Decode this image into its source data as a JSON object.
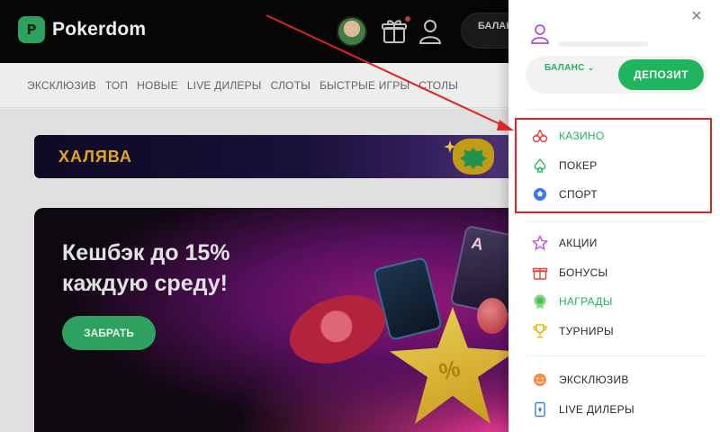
{
  "site": {
    "brand": "Pokerdom",
    "balance_label": "БАЛАН",
    "categories": [
      "ЭКСКЛЮЗИВ",
      "ТОП",
      "НОВЫЕ",
      "LIVE ДИЛЕРЫ",
      "СЛОТЫ",
      "БЫСТРЫЕ ИГРЫ",
      "СТОЛЫ"
    ],
    "freebie_banner": {
      "title": "ХАЛЯВА",
      "letter": "S"
    },
    "promo": {
      "title": "Кешбэк до 15% каждую среду!",
      "button": "ЗАБРАТЬ",
      "card_letter": "A",
      "star_symbol": "%"
    }
  },
  "drawer": {
    "close_glyph": "×",
    "wallet": {
      "balance_label": "БАЛАНС",
      "chevron": "⌄",
      "deposit_label": "ДЕПОЗИТ"
    },
    "primary": [
      {
        "label": "КАЗИНО",
        "icon": "cherries-icon",
        "active": true
      },
      {
        "label": "ПОКЕР",
        "icon": "spade-icon",
        "active": false
      },
      {
        "label": "СПОРТ",
        "icon": "soccer-ball-icon",
        "active": false
      }
    ],
    "secondary": [
      {
        "label": "АКЦИИ",
        "icon": "star-icon",
        "active": false
      },
      {
        "label": "БОНУСЫ",
        "icon": "gift-icon",
        "active": false
      },
      {
        "label": "НАГРАДЫ",
        "icon": "medal-icon",
        "active": true
      },
      {
        "label": "ТУРНИРЫ",
        "icon": "trophy-icon",
        "active": false
      }
    ],
    "tertiary": [
      {
        "label": "ЭКСКЛЮЗИВ",
        "icon": "smiley-icon",
        "active": false
      },
      {
        "label": "LIVE ДИЛЕРЫ",
        "icon": "playing-card-icon",
        "active": false
      }
    ]
  },
  "annotation": {
    "highlight_color": "#e32222",
    "arrow_color": "#e32222"
  },
  "colors": {
    "accent": "#1fb45e",
    "highlight": "#e32222"
  }
}
